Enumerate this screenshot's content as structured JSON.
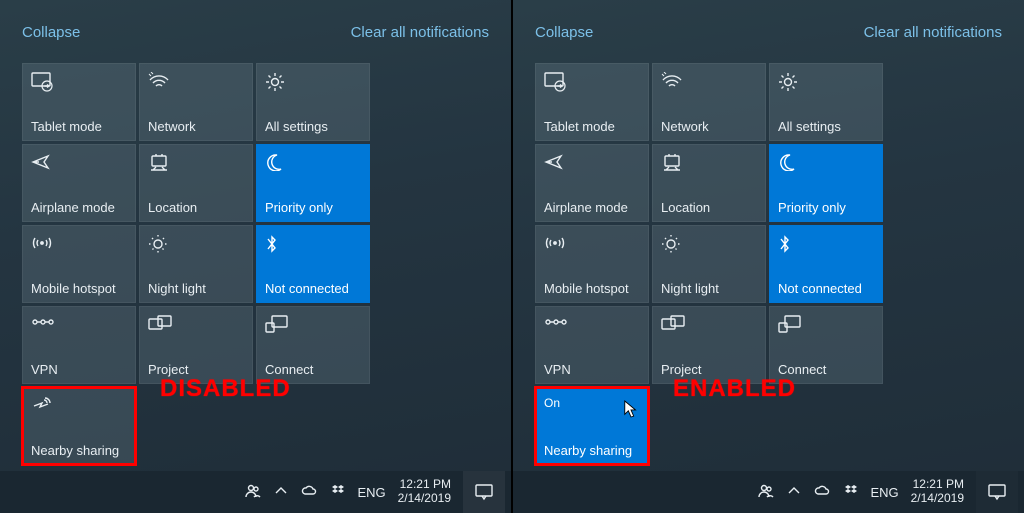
{
  "links": {
    "collapse": "Collapse",
    "clear": "Clear all notifications"
  },
  "tiles": {
    "tablet": {
      "label": "Tablet mode"
    },
    "network": {
      "label": "Network"
    },
    "settings": {
      "label": "All settings"
    },
    "airplane": {
      "label": "Airplane mode"
    },
    "location": {
      "label": "Location"
    },
    "priority": {
      "label": "Priority only"
    },
    "hotspot": {
      "label": "Mobile hotspot"
    },
    "night": {
      "label": "Night light"
    },
    "bt": {
      "label": "Not connected"
    },
    "vpn": {
      "label": "VPN"
    },
    "project": {
      "label": "Project"
    },
    "connect": {
      "label": "Connect"
    },
    "nearby": {
      "label": "Nearby sharing"
    },
    "nearby_on": {
      "status": "On",
      "label": "Nearby sharing"
    }
  },
  "annotations": {
    "disabled": "DISABLED",
    "enabled": "ENABLED"
  },
  "taskbar": {
    "lang": "ENG",
    "time": "12:21 PM",
    "date": "2/14/2019"
  }
}
